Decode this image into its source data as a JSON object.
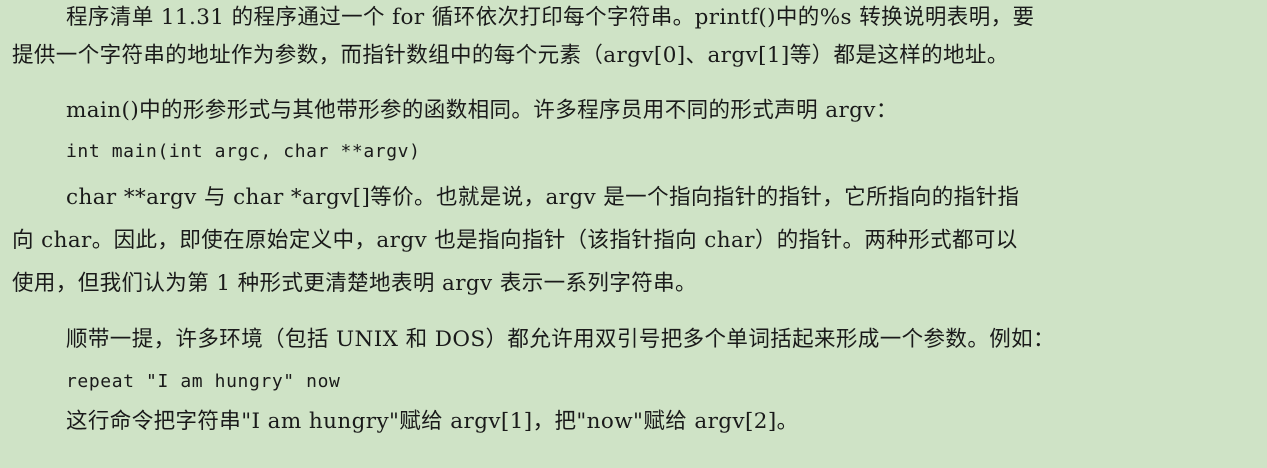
{
  "document": {
    "lines": [
      "程序清单 11.31 的程序通过一个 for 循环依次打印每个字符串。printf()中的%s 转换说明表明，要",
      "提供一个字符串的地址作为参数，而指针数组中的每个元素（argv[0]、argv[1]等）都是这样的地址。",
      "main()中的形参形式与其他带形参的函数相同。许多程序员用不同的形式声明 argv：",
      "int main(int argc, char **argv)",
      "char **argv 与 char *argv[]等价。也就是说，argv 是一个指向指针的指针，它所指向的指针指",
      "向 char。因此，即使在原始定义中，argv 也是指向指针（该指针指向 char）的指针。两种形式都可以",
      "使用，但我们认为第 1 种形式更清楚地表明 argv 表示一系列字符串。",
      "顺带一提，许多环境（包括 UNIX 和 DOS）都允许用双引号把多个单词括起来形成一个参数。例如：",
      "repeat \"I am hungry\" now",
      "这行命令把字符串\"I am hungry\"赋给 argv[1]，把\"now\"赋给 argv[2]。"
    ]
  }
}
